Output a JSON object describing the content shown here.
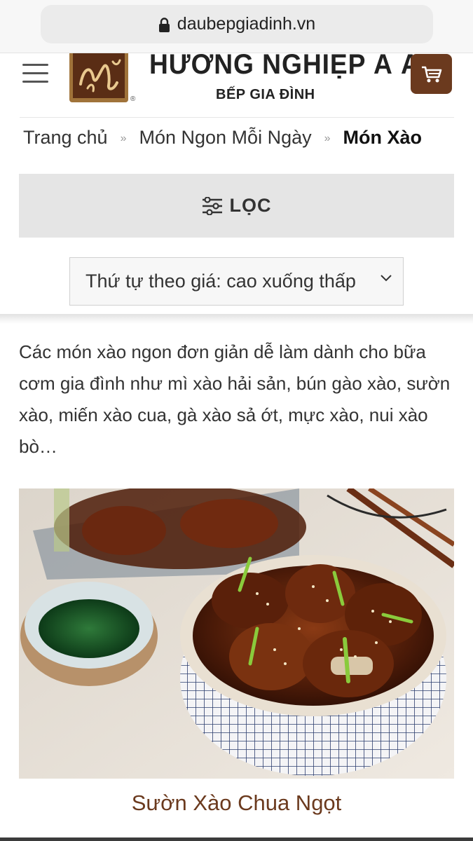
{
  "browser": {
    "url": "daubepgiadinh.vn"
  },
  "header": {
    "brand_name": "HƯƠNG NGHIỆP Á ÂU",
    "brand_sub": "BẾP GIA ĐÌNH",
    "registered_mark": "®",
    "accent_color": "#6b3a1e"
  },
  "breadcrumb": {
    "items": [
      "Trang chủ",
      "Món Ngon Mỗi Ngày",
      "Món Xào"
    ],
    "separator": "»"
  },
  "filter": {
    "label": "LỌC"
  },
  "sort": {
    "selected": "Thứ tự theo giá: cao xuống thấp"
  },
  "category": {
    "description": "Các món xào ngon đơn giản dễ làm dành cho bữa cơm gia đình như mì xào hải sản, bún gào xào, sườn xào, miến xào cua, gà xào sả ớt, mực xào, nui xào bò…"
  },
  "products": [
    {
      "title": "Sườn Xào Chua Ngọt",
      "image": "sweet-and-sour-ribs-photo"
    }
  ],
  "icons": [
    "lock-icon",
    "hamburger-menu-icon",
    "cart-icon",
    "filter-sliders-icon",
    "chevron-down-icon"
  ]
}
